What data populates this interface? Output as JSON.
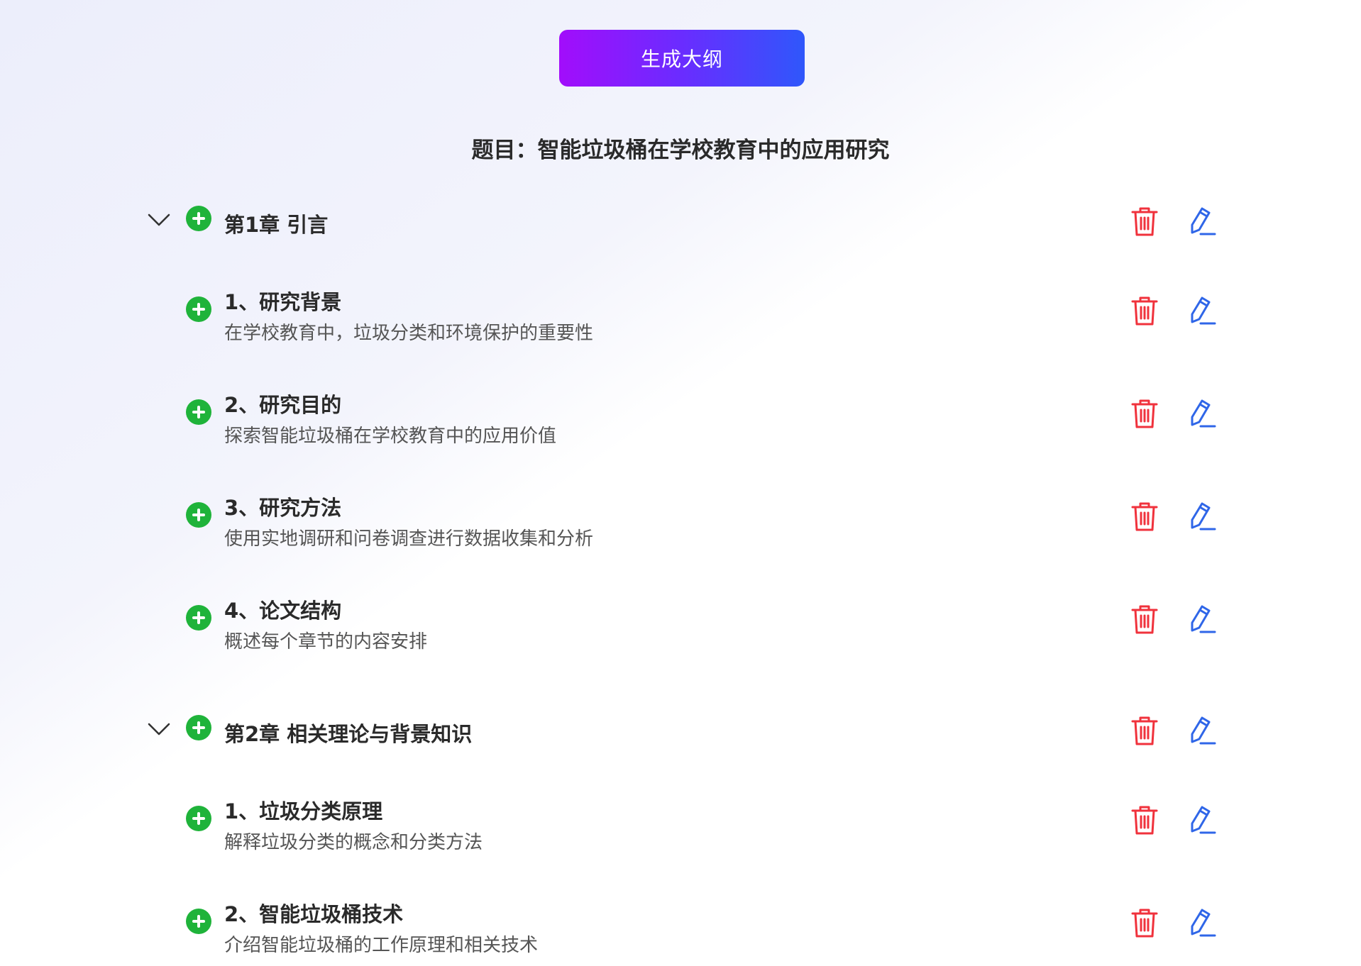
{
  "generate_button": {
    "label": "生成大纲"
  },
  "outline": {
    "title": "题目：智能垃圾桶在学校教育中的应用研究",
    "chapters": [
      {
        "label": "第1章 引言",
        "sections": [
          {
            "title": "1、研究背景",
            "description": "在学校教育中，垃圾分类和环境保护的重要性"
          },
          {
            "title": "2、研究目的",
            "description": "探索智能垃圾桶在学校教育中的应用价值"
          },
          {
            "title": "3、研究方法",
            "description": "使用实地调研和问卷调查进行数据收集和分析"
          },
          {
            "title": "4、论文结构",
            "description": "概述每个章节的内容安排"
          }
        ]
      },
      {
        "label": "第2章 相关理论与背景知识",
        "sections": [
          {
            "title": "1、垃圾分类原理",
            "description": "解释垃圾分类的概念和分类方法"
          },
          {
            "title": "2、智能垃圾桶技术",
            "description": "介绍智能垃圾桶的工作原理和相关技术"
          }
        ]
      }
    ]
  },
  "icons": {
    "chevron": "chevron-down-icon",
    "add": "plus-circle-icon",
    "delete": "trash-icon",
    "edit": "pencil-icon"
  },
  "colors": {
    "button_gradient_start": "#a20dfb",
    "button_gradient_end": "#2f57fb",
    "add_icon": "#1fb33a",
    "delete_icon": "#f0323c",
    "edit_icon": "#2f66e8"
  }
}
